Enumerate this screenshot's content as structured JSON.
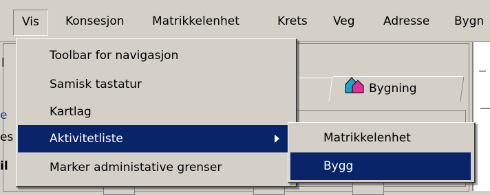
{
  "menubar": {
    "items": [
      "Vis",
      "Konsesjon",
      "Matrikkelenhet",
      "Krets",
      "Veg",
      "Adresse",
      "Bygn"
    ]
  },
  "background": {
    "tab_label": "Bygning",
    "tab_icon": "house-icon",
    "left_fragments": [
      "l",
      "e",
      "es",
      "il"
    ]
  },
  "dropdown": {
    "items": [
      {
        "label": "Toolbar for navigasjon",
        "has_submenu": false
      },
      {
        "label": "Samisk tastatur",
        "has_submenu": false
      },
      {
        "label": "Kartlag",
        "has_submenu": false
      },
      {
        "label": "Aktivitetliste",
        "has_submenu": true
      },
      {
        "label": "Marker administative grenser",
        "has_submenu": false
      }
    ]
  },
  "submenu": {
    "items": [
      "Matrikkelenhet",
      "Bygg"
    ]
  },
  "colors": {
    "selection": "#0a246a",
    "face": "#d4d0c8"
  }
}
